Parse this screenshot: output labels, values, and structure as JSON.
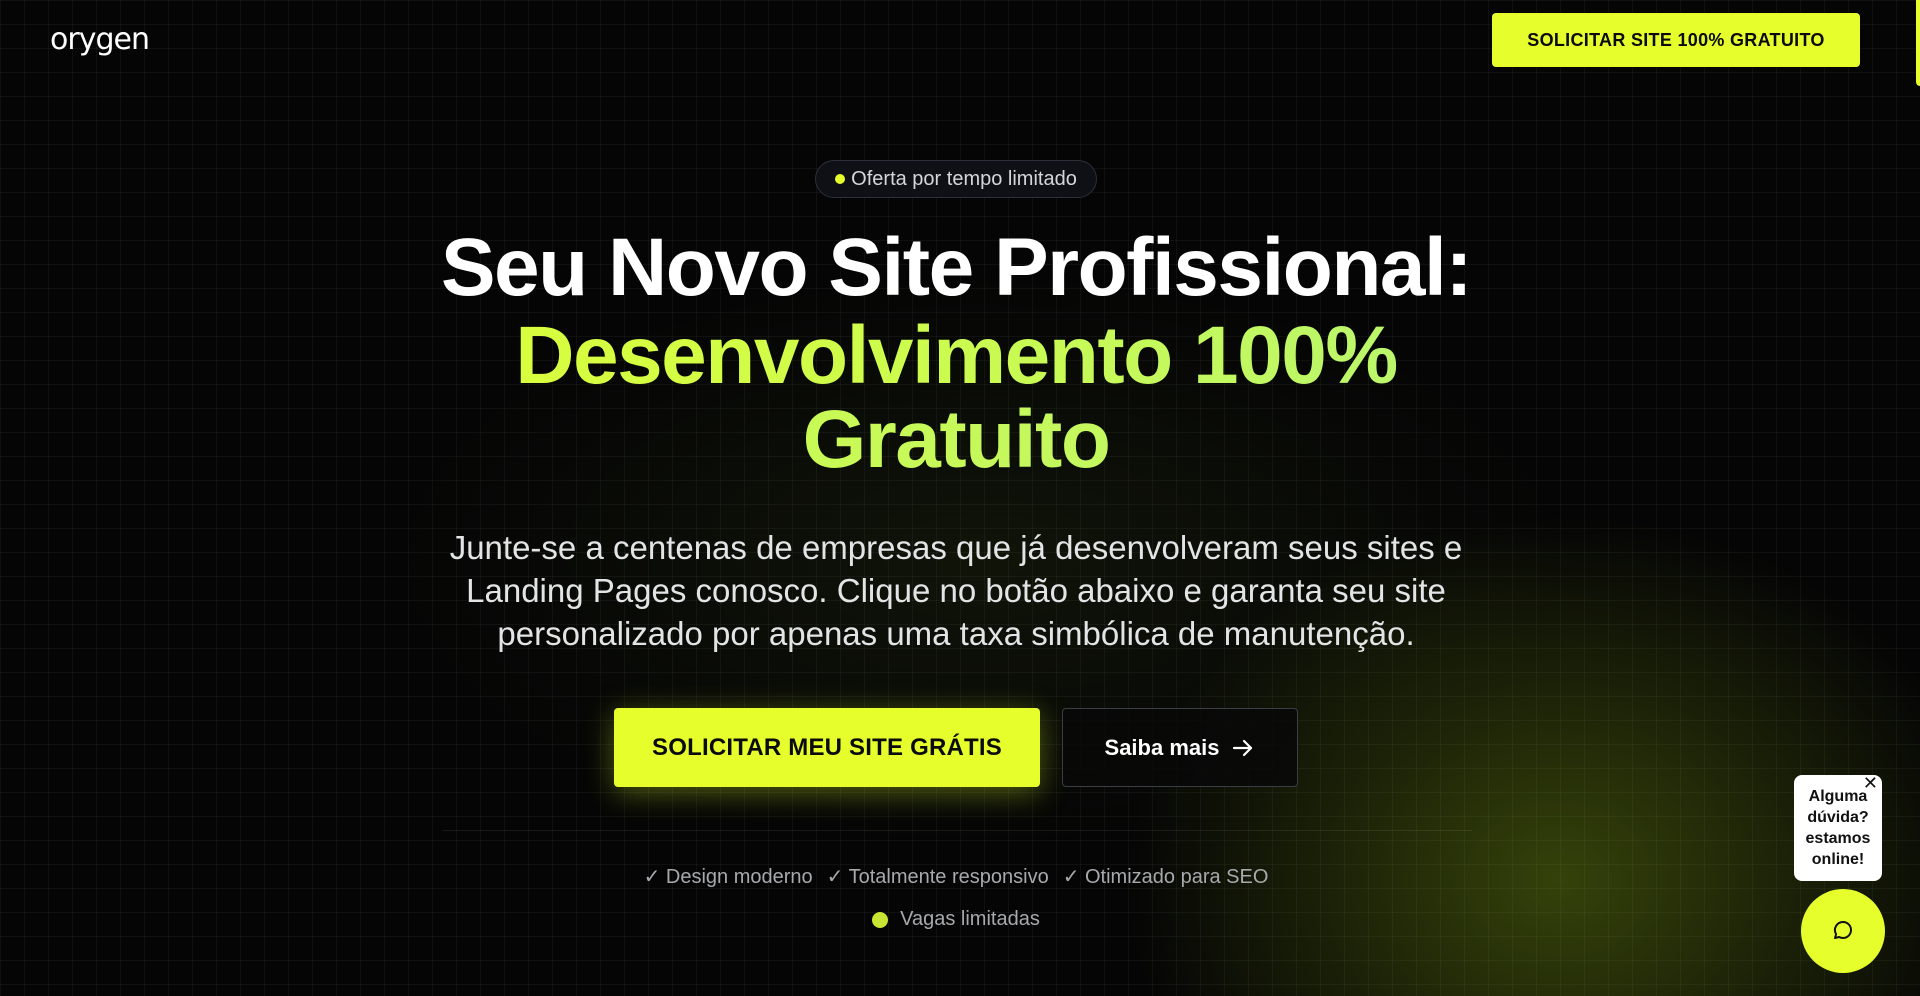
{
  "header": {
    "logo_text": "orygen",
    "cta_label": "SOLICITAR SITE 100% GRATUITO"
  },
  "hero": {
    "badge": "Oferta por tempo limitado",
    "headline_line1": "Seu Novo Site Profissional:",
    "headline_line2": "Desenvolvimento 100%",
    "headline_line3": "Gratuito",
    "subtitle": "Junte-se a centenas de empresas que já desenvolveram seus sites e Landing Pages conosco. Clique no botão abaixo e garanta seu site personalizado por apenas uma taxa simbólica de manutenção.",
    "primary_cta": "SOLICITAR MEU SITE GRÁTIS",
    "secondary_cta": "Saiba mais",
    "features": [
      "✓ Design moderno",
      "✓ Totalmente responsivo",
      "✓ Otimizado para SEO"
    ],
    "urgency": "Vagas limitadas"
  },
  "chat": {
    "line1": "Alguma",
    "line2": "dúvida?",
    "line3": "estamos",
    "line4": "online!",
    "close_symbol": "✕"
  },
  "colors": {
    "accent": "#e6ff2c",
    "background": "#050505",
    "text": "#ffffff",
    "muted_text": "#a7a9ad"
  },
  "icons": [
    "arrow-right-icon",
    "chat-icon",
    "close-icon",
    "status-dot-icon"
  ]
}
